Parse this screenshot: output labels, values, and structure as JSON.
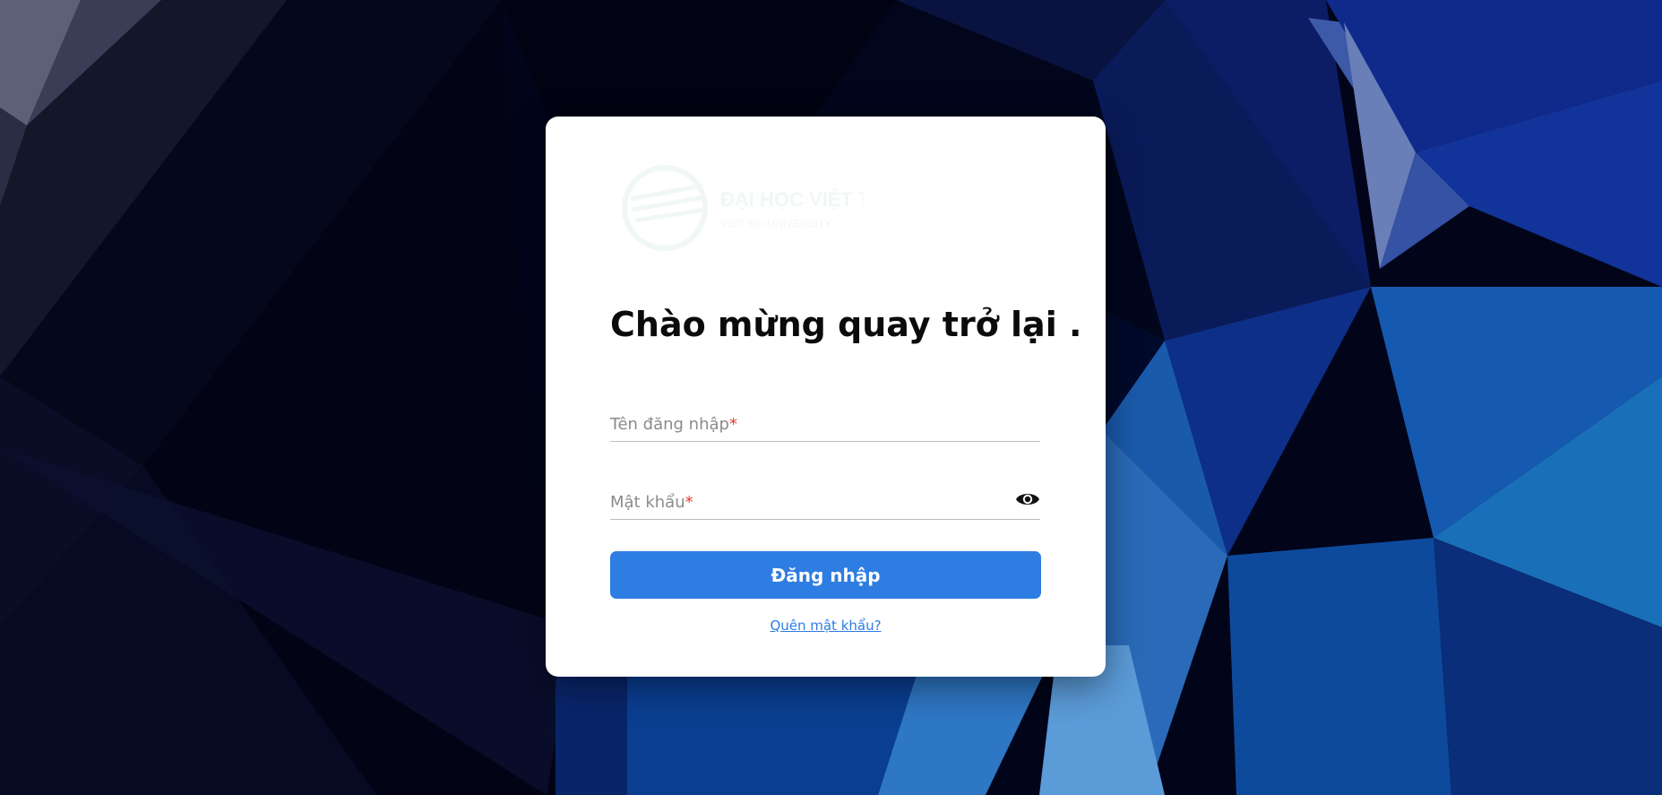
{
  "login": {
    "welcome_heading": "Chào mừng quay trở lại .",
    "username_label": "Tên đăng nhập",
    "password_label": "Mật khẩu",
    "required_marker": "*",
    "login_button_label": "Đăng nhập",
    "forgot_password_link": "Quên mật khẩu?",
    "logo_text_line1": "ĐẠI HỌC VIỆT TRÌ",
    "logo_text_line2": "VIET TRI UNIVERSITY"
  },
  "icons": {
    "password_toggle": "eye-icon",
    "logo": "university-logo"
  },
  "colors": {
    "accent": "#2e7de2",
    "required": "#e53935",
    "card": "#ffffff",
    "background_dark": "#02051a",
    "background_blue": "#0a3a8a"
  }
}
